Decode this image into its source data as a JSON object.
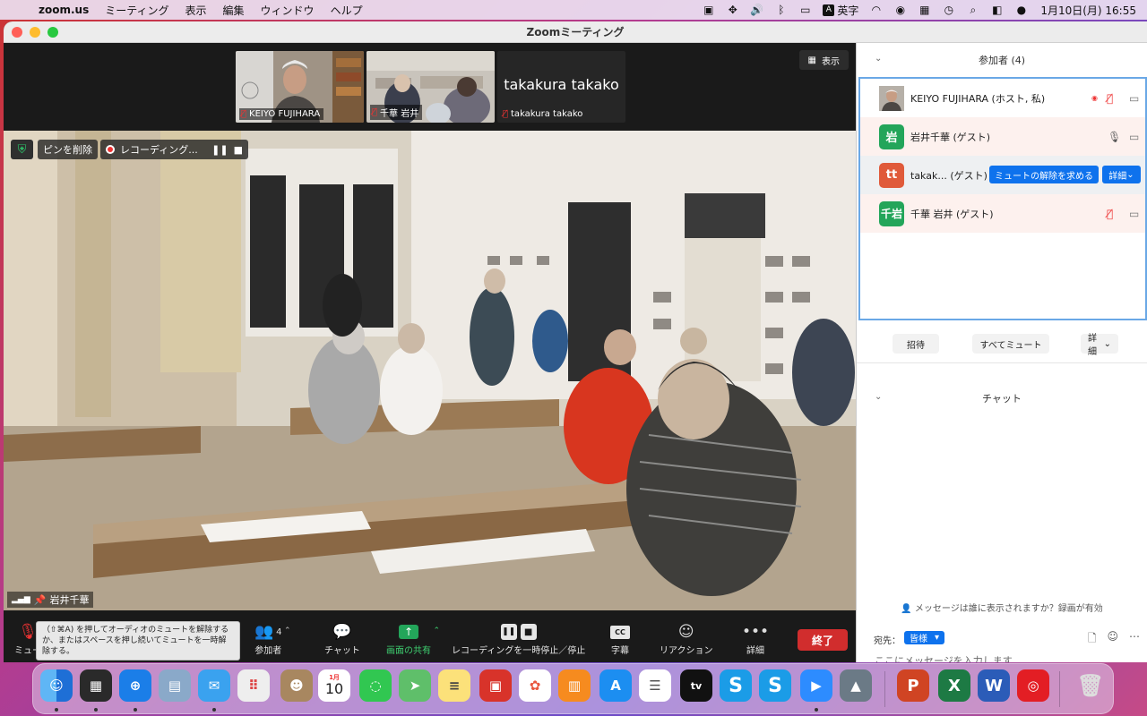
{
  "menubar": {
    "app_name": "zoom.us",
    "items": [
      "ミーティング",
      "表示",
      "編集",
      "ウィンドウ",
      "ヘルプ"
    ],
    "ime_label": "英字",
    "ime_box": "A",
    "datetime": "1月10日(月)  16:55"
  },
  "window": {
    "title": "Zoomミーティング"
  },
  "thumbnails": [
    {
      "name": "KEIYO FUJIHARA"
    },
    {
      "name": "千華 岩井"
    },
    {
      "name": "takakura takako",
      "display_text": "takakura takako"
    }
  ],
  "view_button": "表示",
  "main_video": {
    "unpin_label": "ピンを削除",
    "recording_label": "レコーディング...",
    "speaker_name": "岩井千華"
  },
  "toolbar": {
    "mute_label": "ミュー",
    "participants_label": "参加者",
    "participants_count": "4",
    "chat_label": "チャット",
    "share_label": "画面の共有",
    "recording_label": "レコーディングを一時停止／停止",
    "cc_label": "字幕",
    "cc_icon_text": "CC",
    "reaction_label": "リアクション",
    "more_label": "詳細",
    "end_label": "終了"
  },
  "tooltip": "（⇧⌘A) を押してオーディオのミュートを解除するか、またはスペースを押し続いてミュートを一時解除する。",
  "panel": {
    "participants_title": "参加者 (4)",
    "participants": [
      {
        "name": "KEIYO FUJIHARA (ホスト, 私)",
        "avatar_text": "",
        "avatar_color": "#9aa4ad"
      },
      {
        "name": "岩井千華 (ゲスト)",
        "avatar_text": "岩",
        "avatar_color": "#23a55a"
      },
      {
        "name": "takak...  (ゲスト)",
        "avatar_text": "tt",
        "avatar_color": "#e05a3a"
      },
      {
        "name": "千華 岩井 (ゲスト)",
        "avatar_text": "千岩",
        "avatar_color": "#23a55a"
      }
    ],
    "unmute_request_label": "ミュートの解除を求める",
    "row_more_label": "詳細",
    "invite_label": "招待",
    "mute_all_label": "すべてミュート",
    "more_label": "詳細",
    "chat_title": "チャット",
    "chat_notice": "メッセージは誰に表示されますか？録画が有効",
    "to_label": "宛先：",
    "to_value": "皆様",
    "input_placeholder": "ここにメッセージを入力します..."
  },
  "dock": {
    "calendar_month": "1月",
    "calendar_day": "10"
  },
  "colors": {
    "accent": "#0e72ed",
    "end": "#d12d2d",
    "share_green": "#23a55a",
    "mute_red": "#e33333"
  }
}
